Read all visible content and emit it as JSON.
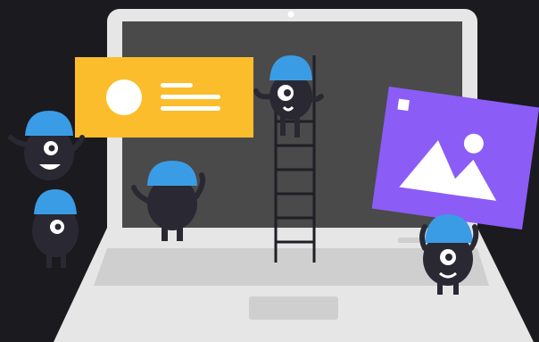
{
  "scene": {
    "background_color": "#1b1a1f",
    "laptop_body_color": "#e6e6e6",
    "laptop_screen_color": "#4a4a4a",
    "keyboard_color": "#cfcfcf",
    "profile_card_color": "#fbbd2b",
    "image_card_color": "#8b5cf6",
    "helmet_color": "#3b9ce6",
    "character_color": "#2a2833",
    "ladder_color": "#1f1f25",
    "icons": [
      "profile-card-icon",
      "image-placeholder-icon",
      "ladder-icon"
    ]
  }
}
